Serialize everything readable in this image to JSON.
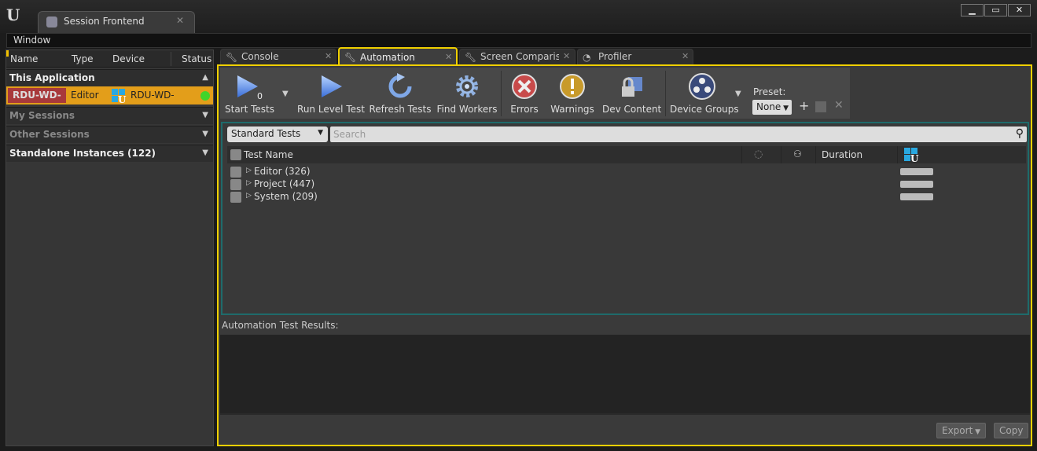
{
  "window": {
    "tab_title": "Session Frontend",
    "controls": [
      "minimize",
      "maximize",
      "close"
    ]
  },
  "menu": {
    "items": [
      "Window"
    ]
  },
  "sessions": {
    "columns": [
      "Name",
      "Type",
      "Device",
      "Status"
    ],
    "this_application": "This Application",
    "active_session": {
      "name": "RDU-WD-",
      "type": "Editor",
      "device": "RDU-WD-",
      "status_color": "#42d42a"
    },
    "my_sessions": "My Sessions",
    "other_sessions": "Other Sessions",
    "standalone": "Standalone Instances (122)"
  },
  "tabs": [
    {
      "label": "Console",
      "icon": "wrench-icon"
    },
    {
      "label": "Automation",
      "icon": "wrench-icon",
      "active": true
    },
    {
      "label": "Screen Comparison",
      "icon": "wrench-icon"
    },
    {
      "label": "Profiler",
      "icon": "profiler-icon"
    }
  ],
  "toolbar": {
    "start_tests": "Start Tests",
    "start_tests_count": "0",
    "run_level_test": "Run Level Test",
    "refresh_tests": "Refresh Tests",
    "find_workers": "Find Workers",
    "errors": "Errors",
    "warnings": "Warnings",
    "dev_content": "Dev Content",
    "device_groups": "Device Groups",
    "preset_label": "Preset:",
    "preset_value": "None"
  },
  "filter": {
    "selected": "Standard Tests",
    "search_placeholder": "Search"
  },
  "tree": {
    "columns": {
      "test_name": "Test Name",
      "duration": "Duration"
    },
    "rows": [
      {
        "label": "Editor (326)"
      },
      {
        "label": "Project (447)"
      },
      {
        "label": "System (209)"
      }
    ]
  },
  "results": {
    "header": "Automation Test Results:",
    "export": "Export",
    "copy": "Copy"
  },
  "colors": {
    "accent": "#f0d000",
    "session_row": "#e39e1a",
    "session_name": "#a8393b",
    "panel_border": "#1e6b6b"
  }
}
